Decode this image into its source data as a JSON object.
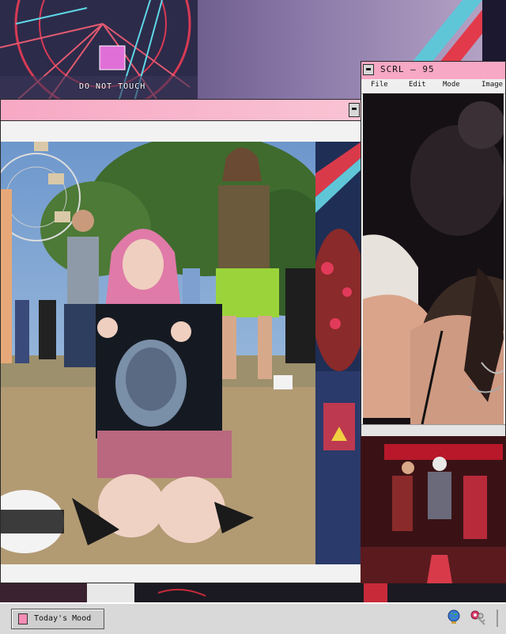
{
  "background": {
    "sign_text": "DO NOT TOUCH"
  },
  "main_window": {
    "minimize_glyph": "▬"
  },
  "scrl_window": {
    "title": "SCRL – 95",
    "close_glyph": "▬",
    "menu": [
      "File",
      "Edit",
      "Mode",
      "Image"
    ]
  },
  "taskbar": {
    "task_button_label": "Today's Mood",
    "icons": [
      "document-icon",
      "globe-icon",
      "keys-icon"
    ]
  },
  "colors": {
    "titlebar_pink": "#f7a8c4",
    "taskbar_gray": "#d9d9d9"
  }
}
